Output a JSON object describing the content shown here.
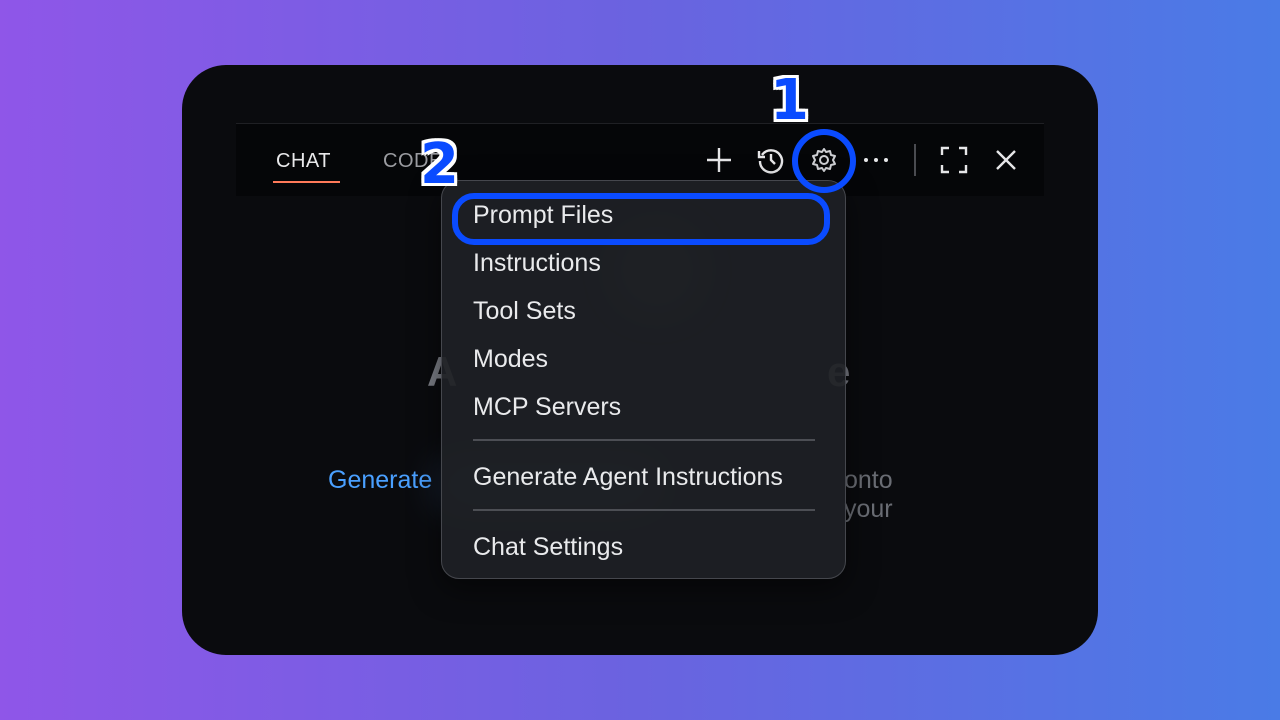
{
  "tabs": [
    {
      "label": "CHAT",
      "active": true
    },
    {
      "label": "CODE",
      "active": false
    }
  ],
  "toolbar": {
    "icons": [
      "plus-icon",
      "history-icon",
      "gear-icon",
      "more-icon",
      "fullscreen-icon",
      "close-icon"
    ]
  },
  "background": {
    "title_left": "A",
    "title_right": "e",
    "line_link": "Generate",
    "line_rest": "onto your"
  },
  "menu": {
    "items": [
      "Prompt Files",
      "Instructions",
      "Tool Sets",
      "Modes",
      "MCP Servers",
      "Generate Agent Instructions",
      "Chat Settings"
    ]
  },
  "annotations": {
    "step1": "1",
    "step2": "2",
    "color": "#0a4bff"
  },
  "colors": {
    "accent_underline": "#ff7a59",
    "link": "#4aa0ff"
  }
}
